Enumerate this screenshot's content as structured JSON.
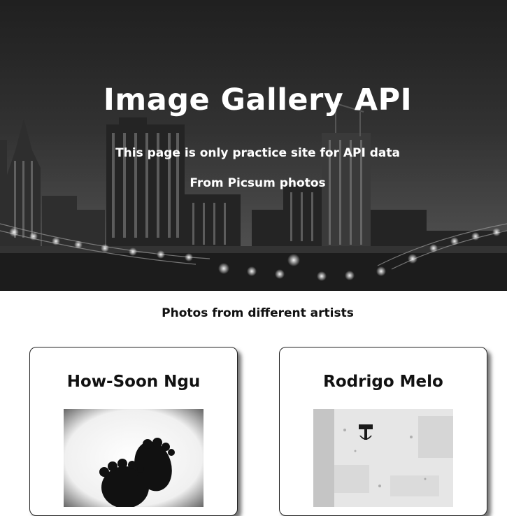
{
  "hero": {
    "title": "Image Gallery API",
    "subtitle_1": "This page is only practice site for API data",
    "subtitle_2": "From Picsum photos"
  },
  "section": {
    "title": "Photos from different artists"
  },
  "cards": [
    {
      "artist": "How-Soon Ngu"
    },
    {
      "artist": "Rodrigo Melo"
    }
  ]
}
